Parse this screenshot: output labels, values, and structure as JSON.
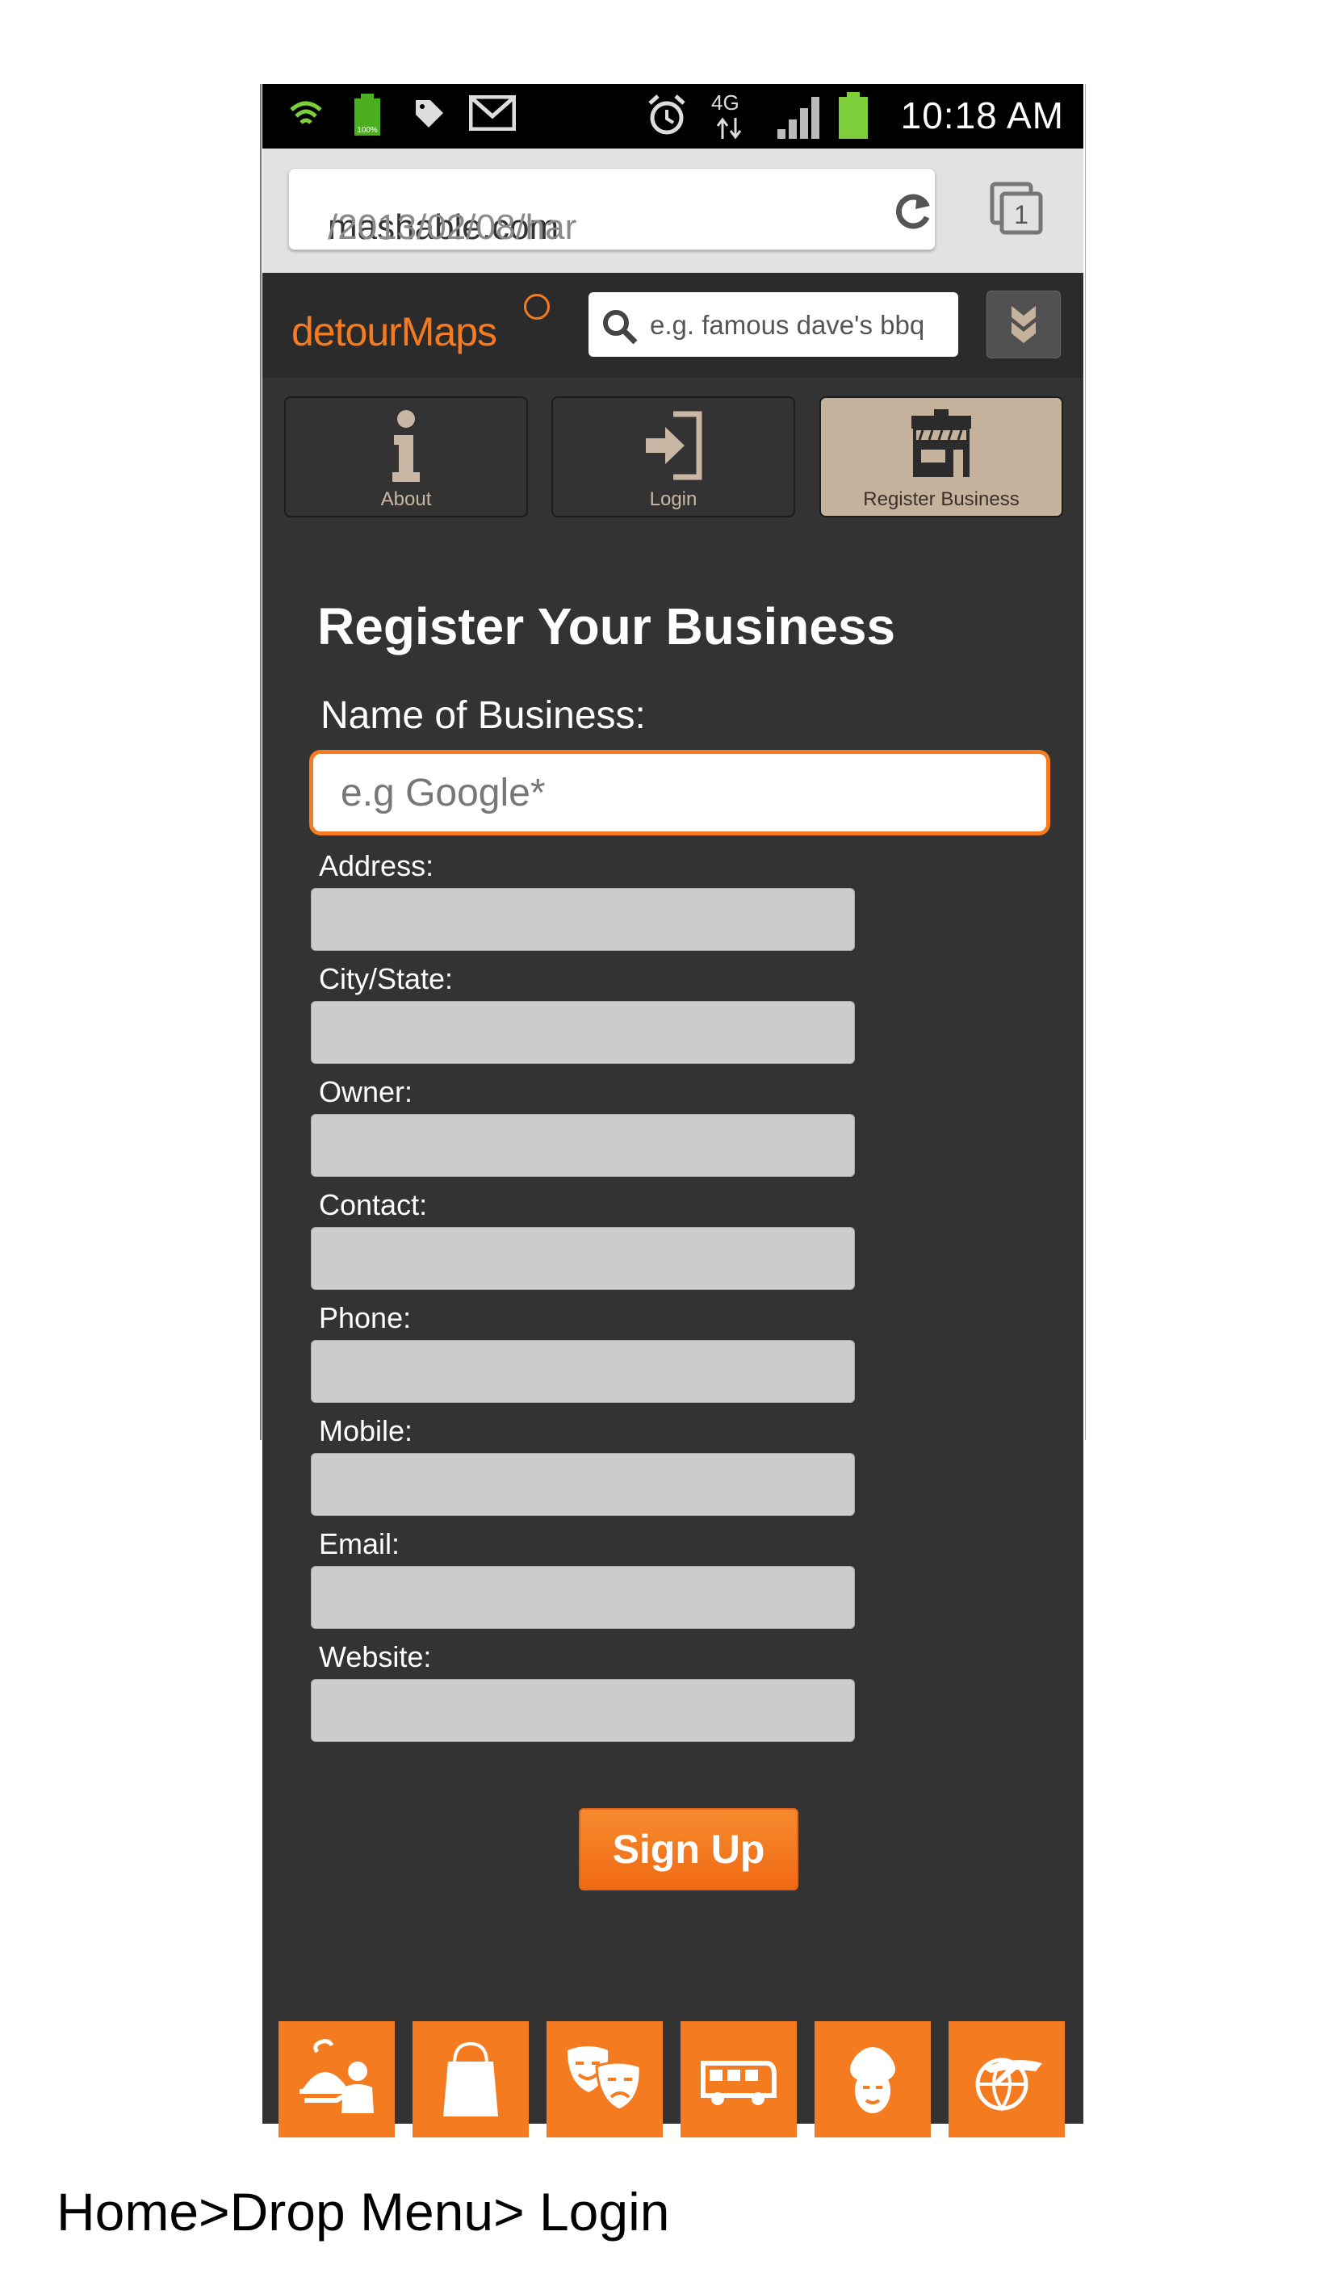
{
  "status_bar": {
    "network": "4G",
    "time": "10:18 AM",
    "battery_small_label": "100%"
  },
  "browser": {
    "url_domain": "mashable.com",
    "url_path": "/2013/02/08/har",
    "tab_count": "1"
  },
  "app": {
    "logo": "detourMaps",
    "search_placeholder": "e.g. famous dave's bbq"
  },
  "nav": [
    {
      "label": "About",
      "icon": "info-icon"
    },
    {
      "label": "Login",
      "icon": "login-icon"
    },
    {
      "label": "Register Business",
      "icon": "storefront-icon",
      "active": true
    }
  ],
  "form": {
    "title": "Register Your Business",
    "name_label": "Name of Business:",
    "name_placeholder": "e.g Google*",
    "fields": [
      "Address:",
      "City/State:",
      "Owner:",
      "Contact:",
      "Phone:",
      "Mobile:",
      "Email:",
      "Website:"
    ],
    "submit_label": "Sign Up"
  },
  "categories": [
    "dining-icon",
    "shopping-bag-icon",
    "theater-masks-icon",
    "bus-icon",
    "spa-icon",
    "travel-globe-icon"
  ],
  "caption": "Home>Drop Menu> Login",
  "colors": {
    "accent": "#f47b20",
    "panel": "#333333",
    "active_nav": "#c5b29c",
    "field": "#cccccc"
  }
}
